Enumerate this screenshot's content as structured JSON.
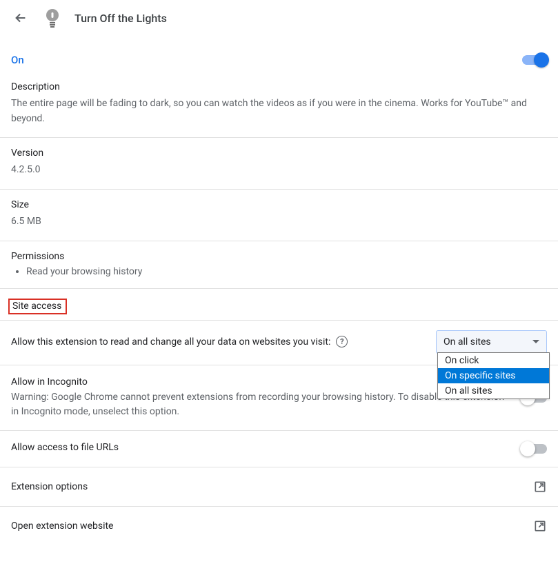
{
  "header": {
    "title": "Turn Off the Lights"
  },
  "status": {
    "label": "On"
  },
  "description": {
    "label": "Description",
    "text": "The entire page will be fading to dark, so you can watch the videos as if you were in the cinema. Works for YouTube™ and beyond."
  },
  "version": {
    "label": "Version",
    "value": "4.2.5.0"
  },
  "size": {
    "label": "Size",
    "value": "6.5 MB"
  },
  "permissions": {
    "label": "Permissions",
    "items": [
      "Read your browsing history"
    ]
  },
  "site_access": {
    "label": "Site access",
    "row_text": "Allow this extension to read and change all your data on websites you visit:",
    "selected": "On all sites",
    "options": [
      "On click",
      "On specific sites",
      "On all sites"
    ],
    "highlighted": "On specific sites"
  },
  "incognito": {
    "label": "Allow in Incognito",
    "desc": "Warning: Google Chrome cannot prevent extensions from recording your browsing history. To disable this extension in Incognito mode, unselect this option."
  },
  "file_urls": {
    "label": "Allow access to file URLs"
  },
  "ext_options": {
    "label": "Extension options"
  },
  "ext_website": {
    "label": "Open extension website"
  }
}
